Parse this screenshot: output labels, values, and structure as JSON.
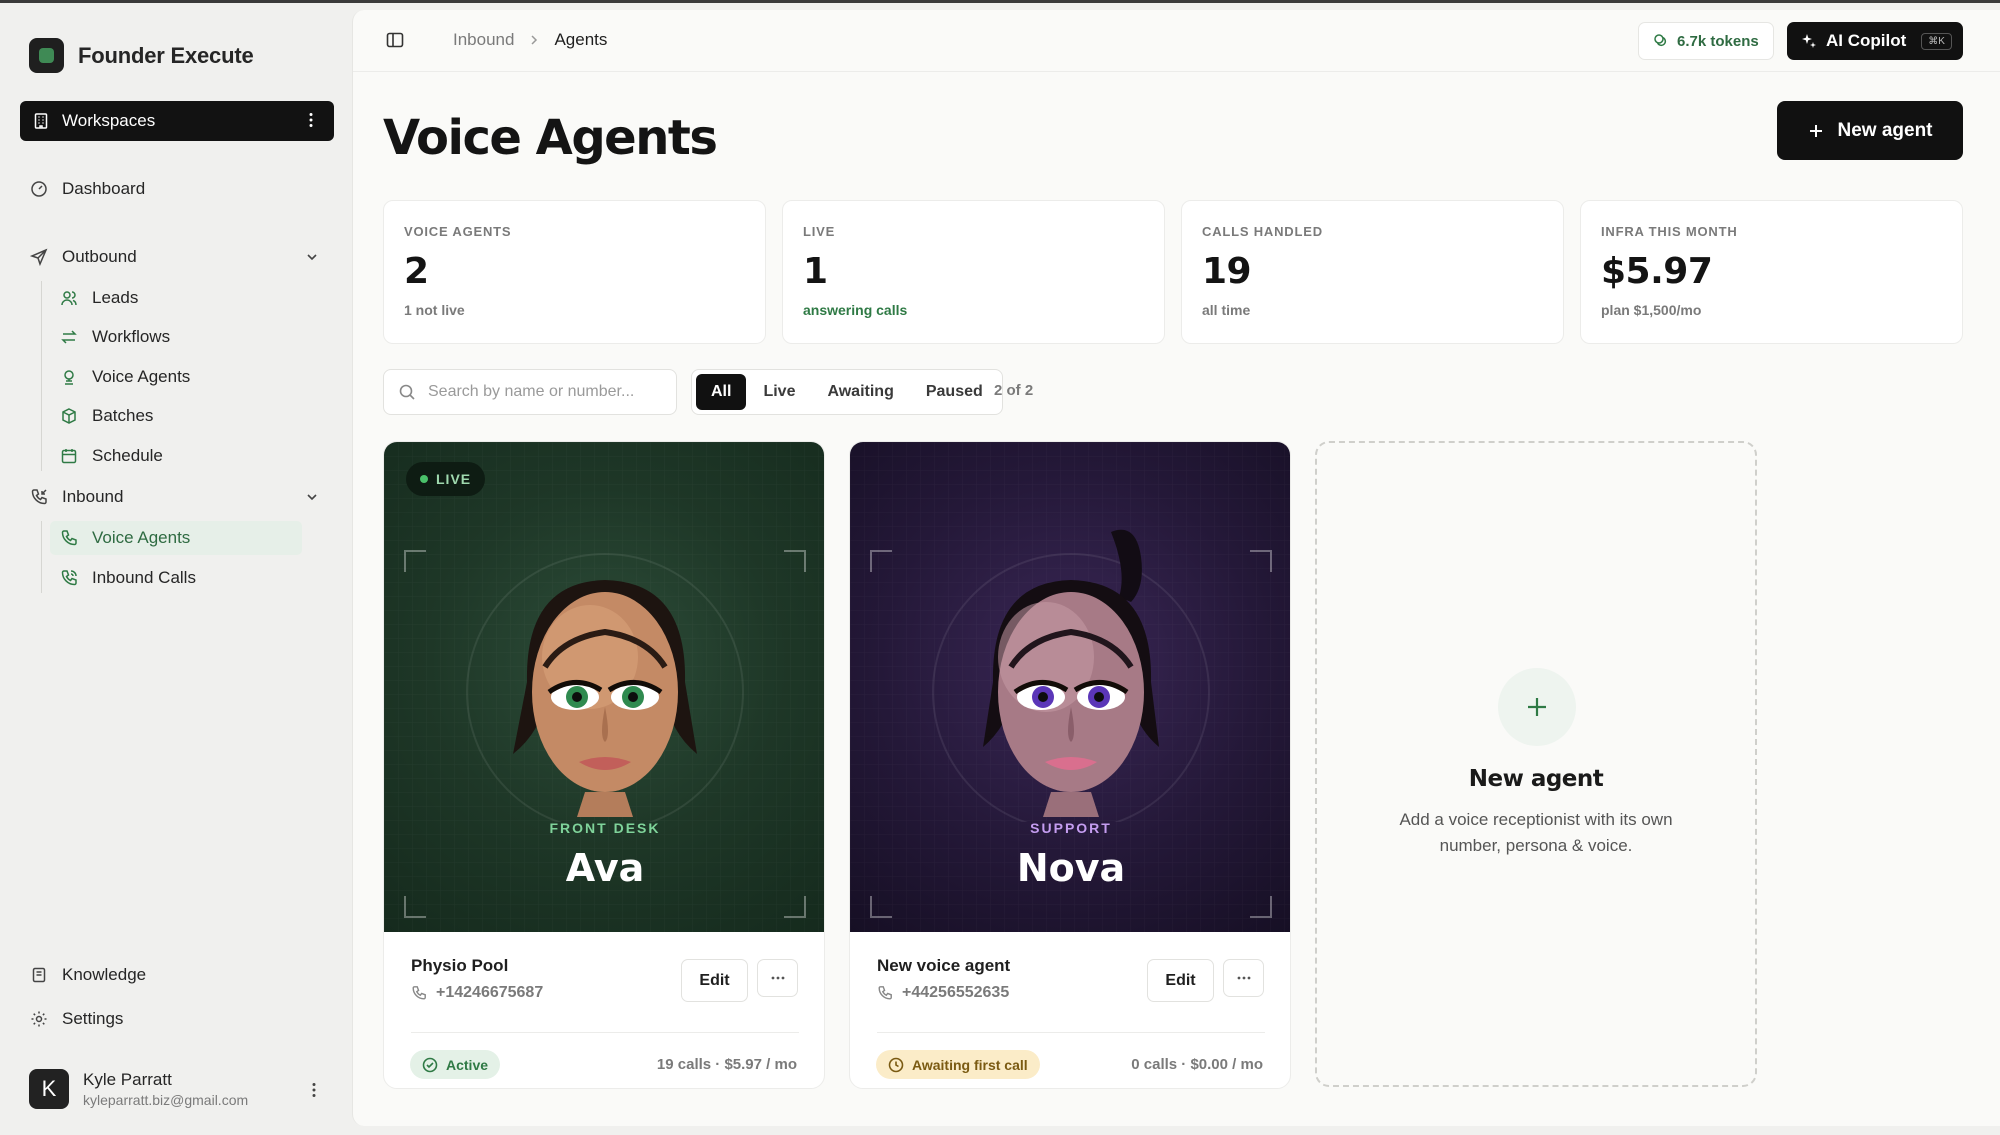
{
  "app": {
    "name": "Founder Execute"
  },
  "sidebar": {
    "workspace_label": "Workspaces",
    "dashboard": "Dashboard",
    "outbound": {
      "label": "Outbound",
      "items": [
        "Leads",
        "Workflows",
        "Voice Agents",
        "Batches",
        "Schedule"
      ]
    },
    "inbound": {
      "label": "Inbound",
      "items": [
        "Voice Agents",
        "Inbound Calls"
      ],
      "active_item": "Voice Agents"
    },
    "knowledge": "Knowledge",
    "settings": "Settings",
    "user": {
      "initial": "K",
      "name": "Kyle Parratt",
      "email": "kyleparratt.biz@gmail.com"
    }
  },
  "header": {
    "breadcrumb": [
      "Inbound",
      "Agents"
    ],
    "tokens": "6.7k tokens",
    "copilot_label": "AI Copilot",
    "copilot_shortcut": "⌘K"
  },
  "page": {
    "title": "Voice Agents",
    "new_agent_button": "New agent"
  },
  "stats": [
    {
      "label": "VOICE AGENTS",
      "value": "2",
      "sub": "1 not live"
    },
    {
      "label": "LIVE",
      "value": "1",
      "sub": "answering calls"
    },
    {
      "label": "CALLS HANDLED",
      "value": "19",
      "sub": "all time"
    },
    {
      "label": "INFRA THIS MONTH",
      "value": "$5.97",
      "sub": "plan $1,500/mo"
    }
  ],
  "toolbar": {
    "search_placeholder": "Search by name or number...",
    "filters": [
      "All",
      "Live",
      "Awaiting",
      "Paused"
    ],
    "active_filter": "All",
    "count": "2 of 2"
  },
  "agents": [
    {
      "badge": "LIVE",
      "role": "FRONT DESK",
      "name": "Ava",
      "title": "Physio Pool",
      "phone": "+14246675687",
      "edit": "Edit",
      "status": "Active",
      "meta": "19 calls · $5.97 / mo",
      "theme_color": "#1e3727",
      "accent": "#7fd39a"
    },
    {
      "role": "SUPPORT",
      "name": "Nova",
      "title": "New voice agent",
      "phone": "+44256552635",
      "edit": "Edit",
      "status": "Awaiting first call",
      "meta": "0 calls · $0.00 / mo",
      "theme_color": "#241838",
      "accent": "#c59df0"
    }
  ],
  "new_agent_card": {
    "title": "New agent",
    "description": "Add a voice receptionist with its own number, persona & voice."
  },
  "colors": {
    "brand_green": "#2f7a45",
    "primary_dark": "#111111",
    "awaiting_bg": "#fbecc8"
  }
}
